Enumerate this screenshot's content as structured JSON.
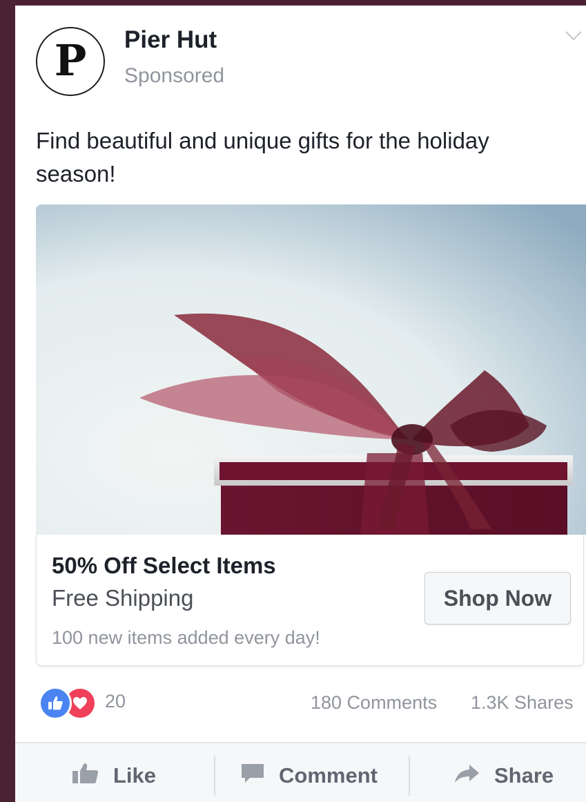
{
  "post": {
    "page_name": "Pier Hut",
    "avatar_letter": "P",
    "sponsored_label": "Sponsored",
    "text": "Find beautiful and unique gifts for the holiday season!"
  },
  "link": {
    "headline": "50% Off Select Items",
    "subhead": "Free Shipping",
    "description": "100 new items added every day!",
    "cta_label": "Shop Now"
  },
  "stats": {
    "reaction_count": "20",
    "comments": "180 Comments",
    "shares": "1.3K Shares"
  },
  "actions": {
    "like": "Like",
    "comment": "Comment",
    "share": "Share"
  },
  "icons": {
    "reactions": [
      "like-reaction-icon",
      "love-reaction-icon"
    ],
    "actions": [
      "thumbs-up-icon",
      "comment-bubble-icon",
      "share-arrow-icon"
    ],
    "menu": "chevron-down-icon"
  },
  "colors": {
    "background": "#4a2234",
    "like_blue": "#4a84f2",
    "love_red": "#f0405a",
    "gift_box": "#6e1430"
  }
}
